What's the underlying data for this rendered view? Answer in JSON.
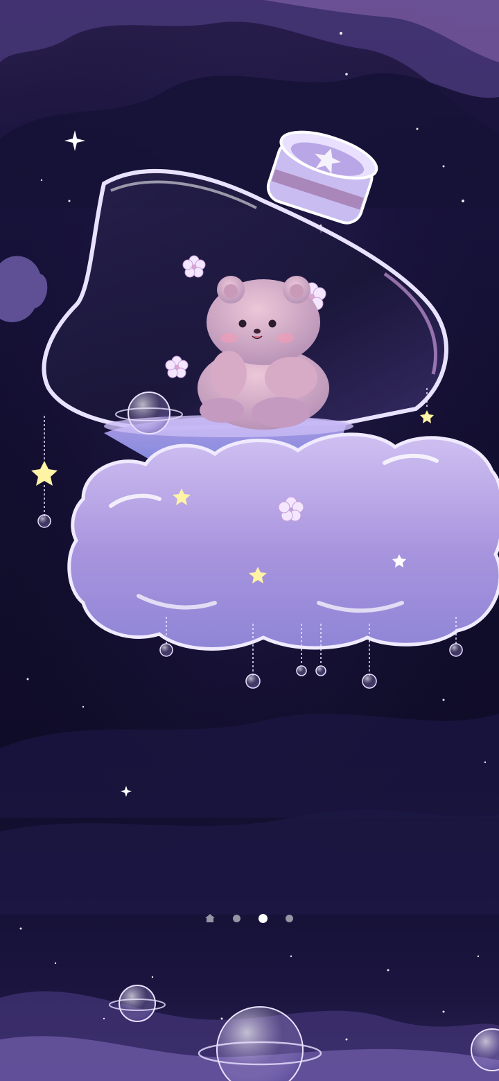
{
  "screen": {
    "type": "launcher-home-screen",
    "wallpaper": "kawaii-bear-in-bottle-on-cloud"
  },
  "page_indicator": {
    "items": [
      {
        "kind": "home",
        "icon": "home-icon",
        "active": false
      },
      {
        "kind": "page",
        "active": false
      },
      {
        "kind": "page",
        "active": true
      },
      {
        "kind": "page",
        "active": false
      }
    ],
    "active_index": 2
  },
  "colors": {
    "sky_top": "#2a1f4d",
    "sky_mid": "#120e2e",
    "cloud": "#b9a6e6",
    "bear": "#d7b2c9",
    "indicator_inactive": "#ffffff8c",
    "indicator_active": "#ffffff"
  }
}
